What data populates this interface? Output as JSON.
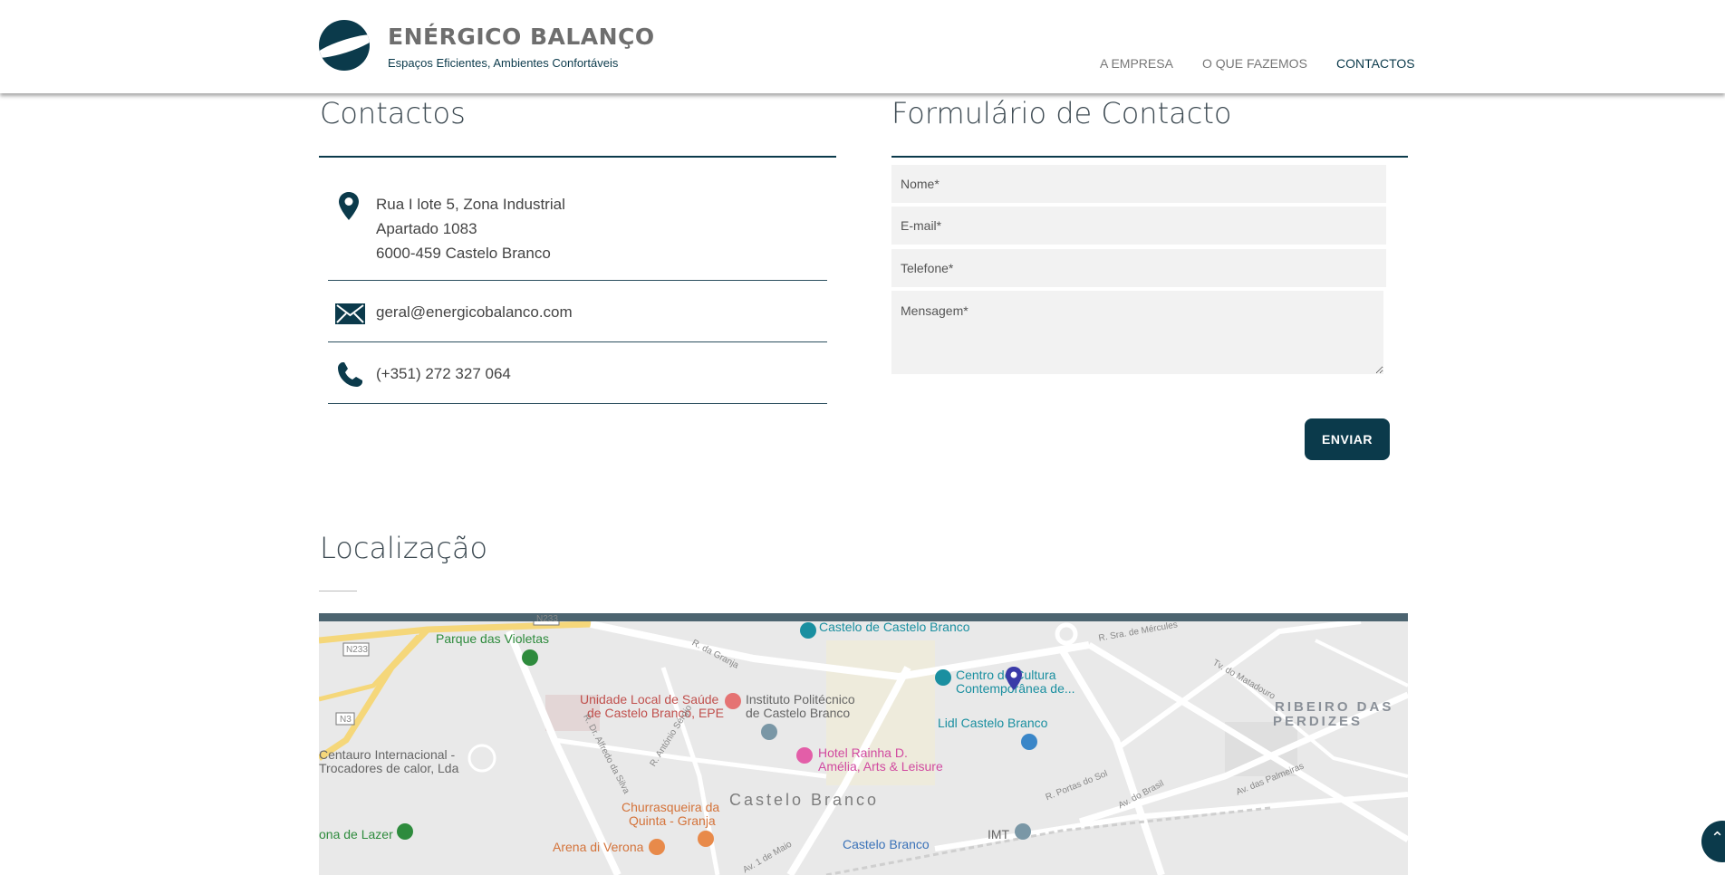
{
  "brand": {
    "name": "ENÉRGICO BALANÇO",
    "tagline": "Espaços Eficientes, Ambientes Confortáveis",
    "primary_color": "#0b3a4b"
  },
  "nav": {
    "items": [
      {
        "label": "A EMPRESA",
        "active": false
      },
      {
        "label": "O QUE FAZEMOS",
        "active": false
      },
      {
        "label": "CONTACTOS",
        "active": true
      }
    ]
  },
  "contacts": {
    "title": "Contactos",
    "address": {
      "icon": "map-pin-icon",
      "line1": "Rua I lote 5, Zona Industrial",
      "line2": "Apartado 1083",
      "line3": "6000-459 Castelo Branco"
    },
    "email": {
      "icon": "envelope-icon",
      "value": "geral@energicobalanco.com"
    },
    "phone": {
      "icon": "phone-icon",
      "value": "(+351) 272 327 064"
    }
  },
  "form": {
    "title": "Formulário de Contacto",
    "name_placeholder": "Nome*",
    "email_placeholder": "E-mail*",
    "phone_placeholder": "Telefone*",
    "message_placeholder": "Mensagem*",
    "submit_label": "ENVIAR"
  },
  "location": {
    "title": "Localização",
    "map_labels": {
      "castle": "Castelo de Castelo Branco",
      "park": "Parque das Violetas",
      "centro_cultura_1": "Centro de Cultura",
      "centro_cultura_2": "Contemporânea de...",
      "ulS_1": "Unidade Local de Saúde",
      "ulS_2": "de Castelo Branco, EPE",
      "ipcb_1": "Instituto Politécnico",
      "ipcb_2": "de Castelo Branco",
      "lidl": "Lidl Castelo Branco",
      "ribeiro_1": "RIBEIRO DAS",
      "ribeiro_2": "PERDIZES",
      "centauro_1": "Centauro Internacional -",
      "centauro_2": "Trocadores de calor, Lda",
      "hotel_1": "Hotel Rainha D.",
      "hotel_2": "Amélia, Arts & Leisure",
      "town": "Castelo Branco",
      "churrasqueira_1": "Churrasqueira da",
      "churrasqueira_2": "Quinta - Granja",
      "lazer": "ona de Lazer",
      "arena": "Arena di Verona",
      "station": "Castelo Branco",
      "imt": "IMT",
      "road_n233": "N233",
      "road_n3": "N3",
      "st_granja": "R. da Granja",
      "st_portas": "R. Portas do Sol",
      "st_brasil": "Av. do Brasil",
      "st_palmeiras": "Av. das Palmeiras",
      "st_maio": "Av. 1 de Maio",
      "st_mercules": "R. Sra. de Mércules",
      "st_matadouro": "Tv. do Matadouro",
      "st_alfredo": "R. Dr. Alfredo da Silva",
      "st_antonio": "R. António Sérgio"
    }
  },
  "scroll_top_icon": "chevron-up-icon"
}
